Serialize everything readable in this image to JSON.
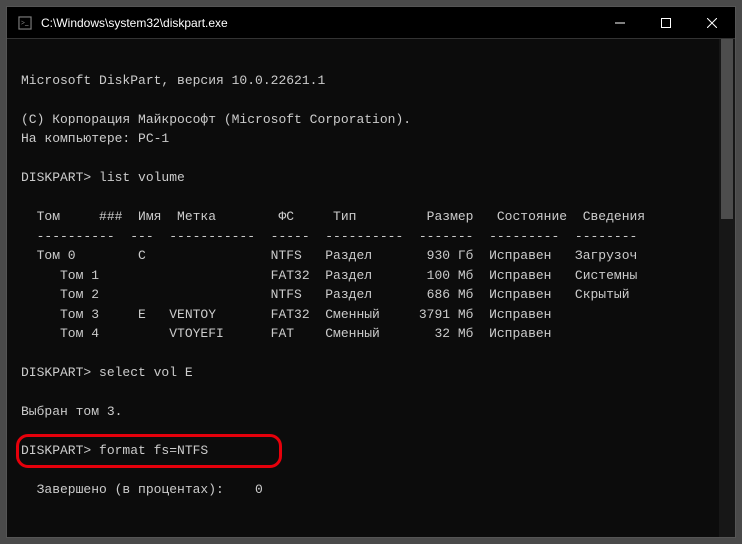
{
  "titlebar": {
    "title": "C:\\Windows\\system32\\diskpart.exe"
  },
  "terminal": {
    "header_line": "Microsoft DiskPart, версия 10.0.22621.1",
    "copyright": "(C) Корпорация Майкрософт (Microsoft Corporation).",
    "computer_line": "На компьютере: PC-1",
    "prompt1": "DISKPART> list volume",
    "table_header": "  Том     ###  Имя  Метка        ФС     Тип         Размер   Состояние  Сведения",
    "table_divider": "  ----------  ---  -----------  -----  ----------  -------  ---------  --------",
    "rows": [
      "  Том 0        C                NTFS   Раздел       930 Гб  Исправен   Загрузоч",
      "     Том 1                      FAT32  Раздел       100 Мб  Исправен   Системны",
      "     Том 2                      NTFS   Раздел       686 Мб  Исправен   Скрытый",
      "     Том 3     E   VENTOY       FAT32  Сменный     3791 Мб  Исправен",
      "     Том 4         VTOYEFI      FAT    Сменный       32 Мб  Исправен"
    ],
    "prompt2": "DISKPART> select vol E",
    "selected_msg": "Выбран том 3.",
    "prompt3": "DISKPART> format fs=NTFS",
    "progress_line": "  Завершено (в процентах):    0"
  }
}
